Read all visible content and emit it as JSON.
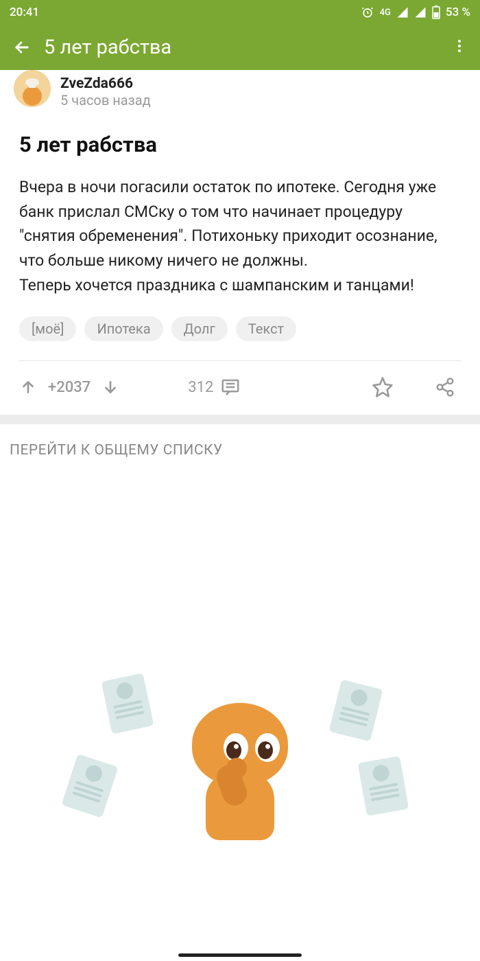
{
  "statusbar": {
    "time": "20:41",
    "network": "4G",
    "battery": "53 %"
  },
  "appbar": {
    "title": "5 лет рабства"
  },
  "post": {
    "author": "ZveZda666",
    "time": "5 часов назад",
    "title": "5 лет рабства",
    "body": "Вчера в ночи погасили остаток по ипотеке. Сегодня уже банк прислал СМСку о том что начинает процедуру \"снятия обременения\". Потихоньку приходит осознание, что больше никому ничего не должны.\nТеперь хочется праздника с шампанским и танцами!",
    "tags": [
      "[моё]",
      "Ипотека",
      "Долг",
      "Текст"
    ],
    "votes": "+2037",
    "comments": "312"
  },
  "list_link": "ПЕРЕЙТИ К ОБЩЕМУ СПИСКУ"
}
